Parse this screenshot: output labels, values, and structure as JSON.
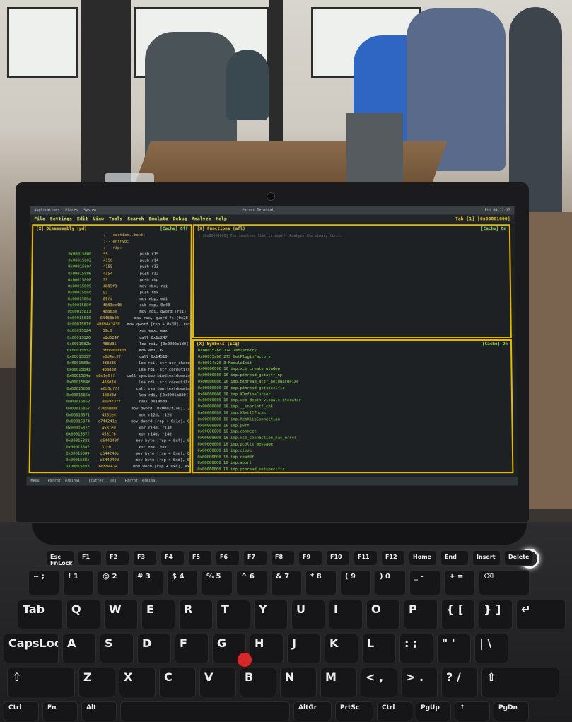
{
  "screen": {
    "topbar": {
      "apps": "Applications",
      "places": "Places",
      "system": "System",
      "title": "Parrot Terminal",
      "clock": "Fri 04 12:17"
    },
    "menu": [
      "File",
      "Settings",
      "Edit",
      "View",
      "Tools",
      "Search",
      "Emulate",
      "Debug",
      "Analyze",
      "Help"
    ],
    "menu_right": "Tab [1] [0x00001000]",
    "disasm_title": "[X] Disassembly (pd)",
    "disasm_cache": "[Cache] Off",
    "disasm_lines": [
      {
        "addr": "",
        "bytes": ";-- section..text:",
        "mn": ""
      },
      {
        "addr": "",
        "bytes": ";-- entry0:",
        "mn": ""
      },
      {
        "addr": "",
        "bytes": ";-- rip:",
        "mn": ""
      },
      {
        "addr": "0x00015800",
        "bytes": "55",
        "mn": "push r15"
      },
      {
        "addr": "0x00015802",
        "bytes": "4156",
        "mn": "push r14"
      },
      {
        "addr": "0x00015804",
        "bytes": "4155",
        "mn": "push r13"
      },
      {
        "addr": "0x00015806",
        "bytes": "4154",
        "mn": "push r12"
      },
      {
        "addr": "0x00015808",
        "bytes": "55",
        "mn": "push rbp"
      },
      {
        "addr": "0x00015809",
        "bytes": "4889f3",
        "mn": "mov rbx, rsi"
      },
      {
        "addr": "0x0001580c",
        "bytes": "53",
        "mn": "push rbx"
      },
      {
        "addr": "0x0001580d",
        "bytes": "89fd",
        "mn": "mov ebp, edi"
      },
      {
        "addr": "0x0001580f",
        "bytes": "4883ec48",
        "mn": "sub rsp, 0x48"
      },
      {
        "addr": "0x00015813",
        "bytes": "488b3e",
        "mn": "mov rdi, qword [rsi]"
      },
      {
        "addr": "0x00015816",
        "bytes": "64488b04",
        "mn": "mov rax, qword fs:[0x28]"
      },
      {
        "addr": "0x0001581f",
        "bytes": "4889442438",
        "mn": "mov qword [rsp + 0x38], rax"
      },
      {
        "addr": "0x00015824",
        "bytes": "31c0",
        "mn": "xor eax, eax"
      },
      {
        "addr": "0x00015826",
        "bytes": "e8d5247",
        "mn": "call 0x1d247"
      },
      {
        "addr": "0x0001582b",
        "bytes": "488d35",
        "mn": "lea rsi, [0x0002c1d0]"
      },
      {
        "addr": "0x00015832",
        "bytes": "bf06000000",
        "mn": "mov edi, 6"
      },
      {
        "addr": "0x00015837",
        "bytes": "e8d4ecff",
        "mn": "call 0x14510"
      },
      {
        "addr": "0x0001583c",
        "bytes": "488d35",
        "mn": "lea rsi, str.usr_share"
      },
      {
        "addr": "0x00015843",
        "bytes": "488d3d",
        "mn": "lea rdi, str.coreutils"
      },
      {
        "addr": "0x0001584a",
        "bytes": "e8d1e0ff",
        "mn": "call sym.imp.bindtextdomain"
      },
      {
        "addr": "0x0001584f",
        "bytes": "488d3d",
        "mn": "lea rdi, str.coreutils"
      },
      {
        "addr": "0x00015856",
        "bytes": "e8b5dfff",
        "mn": "call sym.imp.textdomain"
      },
      {
        "addr": "0x0001585b",
        "bytes": "488d3d",
        "mn": "lea rdi, [0x0001a830]"
      },
      {
        "addr": "0x00015862",
        "bytes": "e869f3ff",
        "mn": "call 0x14bd0"
      },
      {
        "addr": "0x00015867",
        "bytes": "c7050000",
        "mn": "mov dword [0x0002f2a0], 2"
      },
      {
        "addr": "0x00015871",
        "bytes": "4531e4",
        "mn": "xor r12d, r12d"
      },
      {
        "addr": "0x00015874",
        "bytes": "c744241c",
        "mn": "mov dword [rsp + 0x1c], 0"
      },
      {
        "addr": "0x0001587c",
        "bytes": "4531ed",
        "mn": "xor r13d, r13d"
      },
      {
        "addr": "0x0001587f",
        "bytes": "4531f6",
        "mn": "xor r14d, r14d"
      },
      {
        "addr": "0x00015882",
        "bytes": "c644240f",
        "mn": "mov byte [rsp + 0xf], 0"
      },
      {
        "addr": "0x00015887",
        "bytes": "31c0",
        "mn": "xor eax, eax"
      },
      {
        "addr": "0x00015889",
        "bytes": "c644240e",
        "mn": "mov byte [rsp + 0xe], 0"
      },
      {
        "addr": "0x0001588e",
        "bytes": "c644240d",
        "mn": "mov byte [rsp + 0xd], 0"
      },
      {
        "addr": "0x00015893",
        "bytes": "66894424",
        "mn": "mov word [rsp + 0xc], ax"
      }
    ],
    "functions_title": "[X] Functions (afl)",
    "functions_cache": "[Cache] On",
    "functions_note": "; [0x00001000] The function list is empty. Analyze the binary first.",
    "symbols_title": "[X] Symbols (isq)",
    "symbols_cache": "[Cache] On",
    "symbols": [
      "0x00015760 774 TableEntry",
      "0x00015ab0 275 GetPluginFactory",
      "0x00014e20 3 ModuleInit",
      "0x00000000 16 imp.xcb_create_window",
      "0x00000000 16 imp.pthread_getattr_np",
      "0x00000000 16 imp.pthread_attr_getguardsize",
      "0x00000000 16 imp.pthread_getspecific",
      "0x00000000 16 imp.XDefineCursor",
      "0x00000000 16 imp.xcb_depth_visuals_iterator",
      "0x00000000 16 imp.__snprintf_chk",
      "0x00000000 16 imp.XSetICFocus",
      "0x00000000 16 imp.XcbXlibConnection",
      "0x00000000 16 imp.pwrf",
      "0x00000000 16 imp.connect",
      "0x00000000 16 imp.xcb_connection_has_error",
      "0x00000000 16 imp.pcolls_message",
      "0x00000000 16 imp.close",
      "0x00000000 16 imp.readdf",
      "0x00000000 16 imp.abort",
      "0x00000000 16 imp.pthread_setspecific"
    ],
    "taskbar": [
      "Menu",
      "Parrot Terminal",
      "[cutter - ls]",
      "Parrot Terminal"
    ]
  },
  "keyboard": {
    "frow": [
      "Esc FnLock",
      "F1",
      "F2",
      "F3",
      "F4",
      "F5",
      "F6",
      "F7",
      "F8",
      "F9",
      "F10",
      "F11",
      "F12",
      "Home",
      "End",
      "Insert",
      "Delete"
    ],
    "nrow": [
      "~ ;",
      "! 1",
      "@ 2",
      "# 3",
      "$ 4",
      "% 5",
      "^ 6",
      "& 7",
      "* 8",
      "( 9",
      ") 0",
      "_ -",
      "+ =",
      "⌫"
    ],
    "row3": [
      "Tab",
      "Q",
      "W",
      "E",
      "R",
      "T",
      "Y",
      "U",
      "I",
      "O",
      "P",
      "{ [",
      "} ]",
      "↵"
    ],
    "row4": [
      "CapsLock",
      "A",
      "S",
      "D",
      "F",
      "G",
      "H",
      "J",
      "K",
      "L",
      ": ;",
      "\" '",
      "| \\"
    ],
    "row5": [
      "⇧",
      "Z",
      "X",
      "C",
      "V",
      "B",
      "N",
      "M",
      "< ,",
      "> .",
      "? /",
      "⇧"
    ],
    "brow": [
      "Ctrl",
      "Fn",
      "Alt",
      "",
      "AltGr",
      "PrtSc",
      "Ctrl",
      "PgUp",
      "↑",
      "PgDn"
    ]
  }
}
